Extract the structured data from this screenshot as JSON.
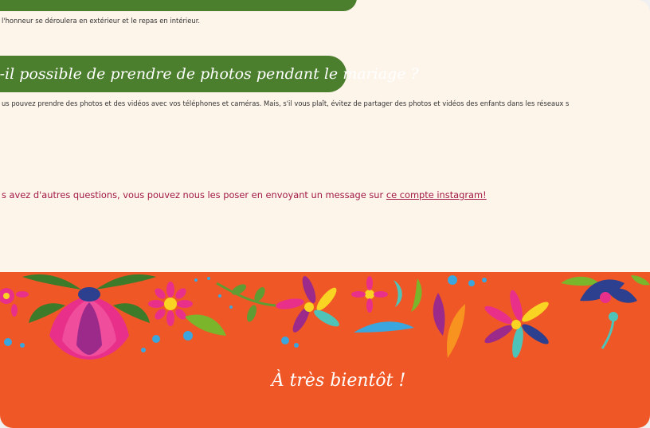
{
  "colors": {
    "page_background": "#fdf4ea",
    "question_pill": "#4b7f2e",
    "link_text": "#a21a47",
    "footer_background": "#ef5826"
  },
  "faq": {
    "previous_answer": "l'honneur se déroulera en extérieur et le repas en intérieur.",
    "question": "t-il possible de prendre de photos pendant le mariage ?",
    "answer": "us pouvez prendre des photos et des vidéos avec vos téléphones et caméras. Mais, s'il vous plaît, évitez de partager des photos et vidéos des enfants dans les réseaux s"
  },
  "contact": {
    "text": "s avez d'autres questions, vous pouvez nous les poser en envoyant un message sur ",
    "link_label": "ce compte instagram!"
  },
  "footer": {
    "decoration": "floral-decoration",
    "farewell": "À très bientôt !"
  }
}
